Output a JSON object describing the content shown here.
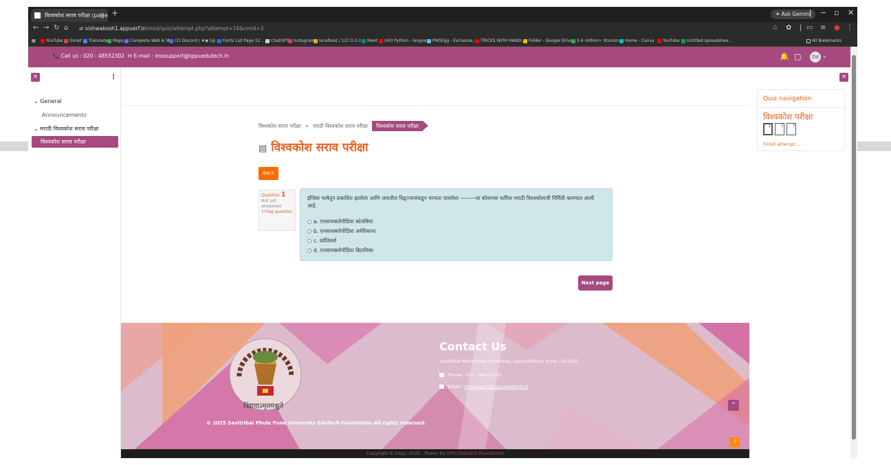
{
  "browser": {
    "tab_title": "विश्वकोश सराव परीक्षा (page 1 of",
    "tab_close": "×",
    "new_tab": "+",
    "ask_gemini": "✦ Ask Gemini",
    "url_host": "vishwakosh1.appuerf.in",
    "url_path": "/mod/quiz/attempt.php?attempt=16&cmid=3",
    "all_bookmarks": "All Bookmarks",
    "bookmarks": [
      {
        "label": "YouTube",
        "color": "#ff0000"
      },
      {
        "label": "Gmail",
        "color": "#ea4335"
      },
      {
        "label": "Translate",
        "color": "#4285f4"
      },
      {
        "label": "Maps",
        "color": "#34a853"
      },
      {
        "label": "Complete Web & M...",
        "color": "#7b61ff"
      },
      {
        "label": "(2) Discord | #◉ [ql...",
        "color": "#5865f2"
      },
      {
        "label": "Fonts List Page 12 ...",
        "color": "#1a73e8"
      },
      {
        "label": "ChatGPT",
        "color": "#cfcfcf"
      },
      {
        "label": "Instagram",
        "color": "#e1306c"
      },
      {
        "label": "localhost / 127.0.0.1...",
        "color": "#f9a825"
      },
      {
        "label": "Meet",
        "color": "#00897b"
      },
      {
        "label": "(40) Python - langua...",
        "color": "#ff0000"
      },
      {
        "label": "PNGEgg - Exclusive...",
        "color": "#4fc3f7"
      },
      {
        "label": "TRICKS WITH HAND...",
        "color": "#ff0000"
      },
      {
        "label": "Folder - Google Drive",
        "color": "#fbbc04"
      },
      {
        "label": "5.6 million+ Stunnin...",
        "color": "#34a853"
      },
      {
        "label": "Home - Canva",
        "color": "#00c4cc"
      },
      {
        "label": "YouTube",
        "color": "#ff0000"
      },
      {
        "label": "Untitled spreadshee...",
        "color": "#0f9d58"
      }
    ]
  },
  "header": {
    "phone_text": "Call us : 020 - 48552302",
    "email_text": "E-mail : lmssupport@sppuedutech.in",
    "avatar": "Dd"
  },
  "left_nav": {
    "close": "×",
    "kebab": "⋮",
    "general": "General",
    "announcements": "Announcements",
    "section": "मराठी विश्वकोश सराव परीक्षा",
    "active_item": "विश्वकोश सराव परीक्षा"
  },
  "breadcrumb": {
    "item1": "विश्वकोश सराव परीक्षा",
    "item2": "मराठी विश्वकोश सराव परीक्षा",
    "active": "विश्वकोश सराव परीक्षा"
  },
  "page_title": "विश्वकोश सराव परीक्षा",
  "back_label": "Back",
  "question": {
    "label": "Question",
    "number": "1",
    "status": "Not yet answered",
    "flag": "Flag question",
    "text": "इंग्लिश भाषेतून प्रकाशित झालेला आणि जगातील विद्वज्जनांकडून मान्यता पावलेला ———या कोशाच्या धर्तीवर मराठी विश्वकोशाची निर्मिती करण्यात आली आहे.",
    "options": [
      {
        "letter": "a.",
        "text": "एनसायक्लोपीडिया कोलंबिया"
      },
      {
        "letter": "b.",
        "text": "एनसायक्लोपीडिया अमेरिकाना"
      },
      {
        "letter": "c.",
        "text": "कॉलियर्स"
      },
      {
        "letter": "d.",
        "text": "एनसायक्लोपीडिया ब्रिटानिका"
      }
    ]
  },
  "next_label": "Next page",
  "quiz_nav": {
    "close": "×",
    "title": "Quiz navigation",
    "subtitle": "विश्वकोश परीक्षा",
    "boxes": [
      "1",
      "2",
      "3"
    ],
    "finish": "Finish attempt ..."
  },
  "footer": {
    "logo_text": "विद्ययाऽमृतमश्नुते",
    "contact_title": "Contact Us",
    "address": "Savitribai Phule Pune University, Ganeshkhind, Pune - 411007",
    "phone": "Phone : 020 - 48552302",
    "email_prefix": "Email : ",
    "email": "lmssupport@sppuedutech.in",
    "copyright": "© 2025 Savitribai Phule Pune University EduTech Foundation.All rights reserved.",
    "up": "⌃",
    "help": "?",
    "bottom_text": "Copyright & Copy; 2025 - Power by ",
    "bottom_brand": "SPPU Edutech Foundation"
  },
  "colors": {
    "brand": "#a5497e",
    "accent": "#e8611f",
    "back_button": "#ff6a00",
    "question_bg": "#cfe6ea"
  }
}
